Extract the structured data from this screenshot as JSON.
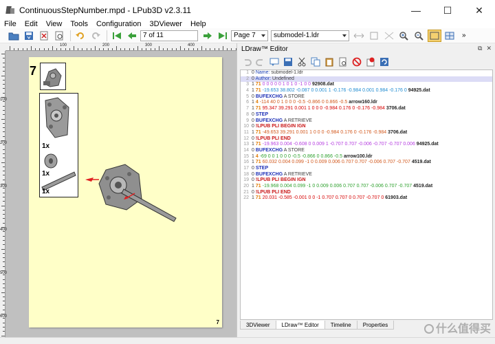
{
  "window": {
    "title": "ContinuousStepNumber.mpd - LPub3D v2.3.11",
    "minimize_glyph": "—",
    "maximize_glyph": "☐",
    "close_glyph": "✕"
  },
  "menu": [
    "File",
    "Edit",
    "View",
    "Tools",
    "Configuration",
    "3DViewer",
    "Help"
  ],
  "toolbar": {
    "page_field": "7 of 11",
    "page_select": "Page 7",
    "submodel_select": "submodel-1.ldr",
    "overflow": "»"
  },
  "page_view": {
    "step_number": "7",
    "page_number": "7",
    "pli_quantities": [
      "1x",
      "1x",
      "1x"
    ],
    "ruler_top_labels": [
      "100",
      "200",
      "300",
      "400"
    ],
    "ruler_left_labels": [
      "100",
      "200",
      "300",
      "400",
      "500",
      "600"
    ]
  },
  "editor": {
    "title": "LDraw™ Editor",
    "undock_glyph": "⧉",
    "close_glyph": "✕",
    "tabs": [
      "3DViewer",
      "LDraw™ Editor",
      "Timeline",
      "Properties"
    ],
    "active_tab": "LDraw™ Editor",
    "lines": [
      {
        "n": "1",
        "type": "0",
        "rest_label": "Name:",
        "rest": " submodel-1.ldr"
      },
      {
        "n": "2",
        "type": "0",
        "rest_label": "Author:",
        "rest": " Undefined"
      },
      {
        "n": "3",
        "type": "1",
        "color": "71",
        "nums": "0 0 0 0 0 1 0 1 0 -1 0 0",
        "file": "92908.dat"
      },
      {
        "n": "4",
        "type": "1",
        "color": "71",
        "nums": "-19.653 38.802 -0.087 0 0.001 1 -0.176 -0.984 0.001 0.984 -0.176 0",
        "file": "94925.dat"
      },
      {
        "n": "5",
        "type": "0",
        "kw": "BUFEXCHG",
        "kw_rest": " A STORE"
      },
      {
        "n": "6",
        "type": "1",
        "color": "4",
        "nums": "-114 40 0 1 0 0 0 -0.5 -0.866 0 0.866 -0.5",
        "file": "arrow160.ldr"
      },
      {
        "n": "7",
        "type": "1",
        "color": "71",
        "nums": "95.347 39.291 0.001 1 0 0 0 -0.984 0.176 0 -0.176 -0.984",
        "file": "3706.dat"
      },
      {
        "n": "8",
        "type": "0",
        "kw": "STEP",
        "kw_rest": ""
      },
      {
        "n": "9",
        "type": "0",
        "kw": "BUFEXCHG",
        "kw_rest": " A RETRIEVE"
      },
      {
        "n": "10",
        "type": "0",
        "meta": "!LPUB PLI BEGIN IGN"
      },
      {
        "n": "11",
        "type": "1",
        "color": "71",
        "nums": "-49.653 39.291 0.001 1 0 0 0 -0.984 0.176 0 -0.176 -0.984",
        "file": "3706.dat"
      },
      {
        "n": "12",
        "type": "0",
        "meta": "!LPUB PLI END"
      },
      {
        "n": "13",
        "type": "1",
        "color": "71",
        "nums": "-19.963 0.004 -0.608 0 0.009 1 -0.707 0.707 -0.006 -0.707 -0.707 0.006",
        "file": "94925.dat"
      },
      {
        "n": "14",
        "type": "0",
        "kw": "BUFEXCHG",
        "kw_rest": " A STORE"
      },
      {
        "n": "15",
        "type": "1",
        "color": "4",
        "nums": "-69 0 0 1 0 0 0 -0.5 -0.866 0 0.866 -0.5",
        "file": "arrow100.ldr"
      },
      {
        "n": "16",
        "type": "1",
        "color": "71",
        "nums": "60.032 0.004 0.099 -1 0 0.009 0.006 0.707 0.707 -0.006 0.707 -0.707",
        "file": "4519.dat"
      },
      {
        "n": "17",
        "type": "0",
        "kw": "STEP",
        "kw_rest": ""
      },
      {
        "n": "18",
        "type": "0",
        "kw": "BUFEXCHG",
        "kw_rest": " A RETRIEVE"
      },
      {
        "n": "19",
        "type": "0",
        "meta": "!LPUB PLI BEGIN IGN"
      },
      {
        "n": "20",
        "type": "1",
        "color": "71",
        "nums": "-19.968 0.004 0.099 -1 0 0.009 0.006 0.707 0.707 -0.006 0.707 -0.707",
        "file": "4519.dat"
      },
      {
        "n": "21",
        "type": "0",
        "meta": "!LPUB PLI END"
      },
      {
        "n": "22",
        "type": "1",
        "color": "71",
        "nums": "20.031 -0.585 -0.001 0 0 -1 0.707 0.707 0 0.707 -0.707 0",
        "file": "61903.dat"
      }
    ]
  },
  "watermark": "什么值得买",
  "colors": {
    "page_bg": "#ffffc8",
    "view_bg": "#c0c0c0",
    "highlight_line": "#dcdcf6"
  }
}
